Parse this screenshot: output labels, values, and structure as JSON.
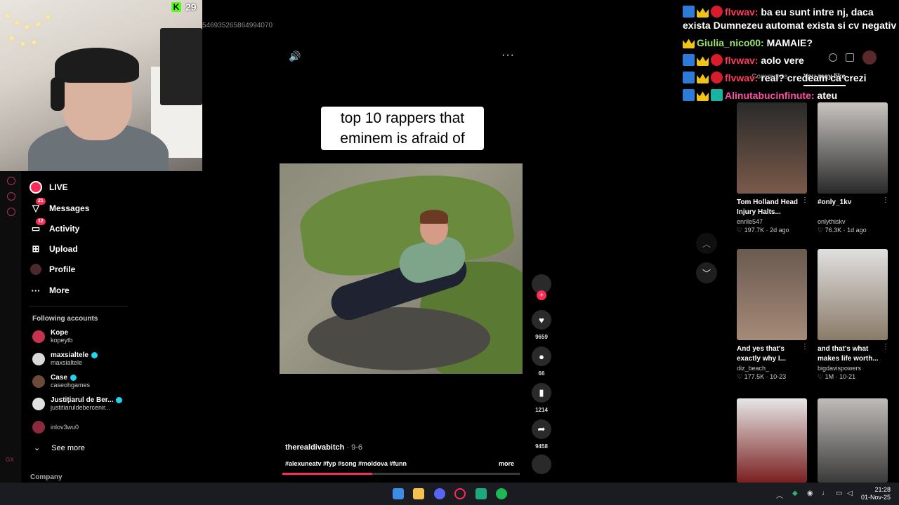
{
  "stream": {
    "kick_viewers": "29",
    "overlay_id": "546935265864994070"
  },
  "sidebar": {
    "nav": [
      {
        "label": "LIVE",
        "icon": "live-icon"
      },
      {
        "label": "Messages",
        "icon": "messages-icon",
        "badge": "21"
      },
      {
        "label": "Activity",
        "icon": "activity-icon",
        "badge": "12"
      },
      {
        "label": "Upload",
        "icon": "upload-icon"
      },
      {
        "label": "Profile",
        "icon": "profile-icon"
      },
      {
        "label": "More",
        "icon": "more-icon"
      }
    ],
    "following_title": "Following accounts",
    "accounts": [
      {
        "name": "Kope",
        "handle": "kopeytb",
        "verified": false
      },
      {
        "name": "maxsialtele",
        "handle": "maxsialtele",
        "verified": true
      },
      {
        "name": "Case",
        "handle": "caseohgames",
        "verified": true
      },
      {
        "name": "Justițiarul de Ber...",
        "handle": "justitiarulde­bercenir...",
        "verified": true
      },
      {
        "name": "",
        "handle": "inlov3wu0",
        "verified": false
      }
    ],
    "see_more": "See more",
    "company": "Company",
    "gx": "GX"
  },
  "video": {
    "caption_line1": "top 10 rappers that",
    "caption_line2": "eminem is afraid of",
    "author": "therealdivabitch",
    "date": " · 9-6",
    "tags": "#alexuneatv #fyp #song #moldova #funn",
    "more": "more",
    "progress": 0.38,
    "likes": "9659",
    "comments": "66",
    "saves": "1214",
    "shares": "9458"
  },
  "chat": [
    {
      "badges": [
        "mod",
        "crown",
        "red"
      ],
      "user": "flvwav:",
      "user_color": "red",
      "msg": " ba eu sunt intre nj, daca exista Dumnezeu automat exista si cv negativ"
    },
    {
      "badges": [
        "crown"
      ],
      "user": "Giulia_nico00:",
      "user_color": "green",
      "msg": " MAMAIE?"
    },
    {
      "badges": [
        "mod",
        "crown",
        "red"
      ],
      "user": "flvwav:",
      "user_color": "red",
      "msg": " aolo vere"
    },
    {
      "badges": [
        "mod",
        "crown",
        "red"
      ],
      "user": "flvwav:",
      "user_color": "red",
      "msg": " real? credeam ca crezi"
    },
    {
      "badges": [
        "mod",
        "crown",
        "teal"
      ],
      "user": "Alinutabucinfinute:",
      "user_color": "pink",
      "msg": " ateu"
    }
  ],
  "right_panel": {
    "tab_comments": "Comments",
    "tab_you_may_like": "You may like",
    "cards": [
      {
        "title": "Tom Holland Head Injury Halts...",
        "author": "enrile547",
        "likes": "197.7K",
        "when": "2d ago"
      },
      {
        "title": "#only_1kv",
        "author": "onlythiskv",
        "likes": "76.3K",
        "when": "1d ago"
      },
      {
        "title": "And yes that's exactly why I...",
        "author": "diz_beach_",
        "likes": "177.5K",
        "when": "10-23"
      },
      {
        "title": "and that's what makes life worth...",
        "author": "bigdavispowers",
        "likes": "1M",
        "when": "10-21"
      },
      {
        "title": "",
        "author": "",
        "likes": "",
        "when": ""
      },
      {
        "title": "",
        "author": "",
        "likes": "",
        "when": ""
      }
    ]
  },
  "taskbar": {
    "time": "21:28",
    "date": "01-Nov-25"
  },
  "colors": {
    "accent": "#fe2c55",
    "kick_green": "#53fc18"
  }
}
